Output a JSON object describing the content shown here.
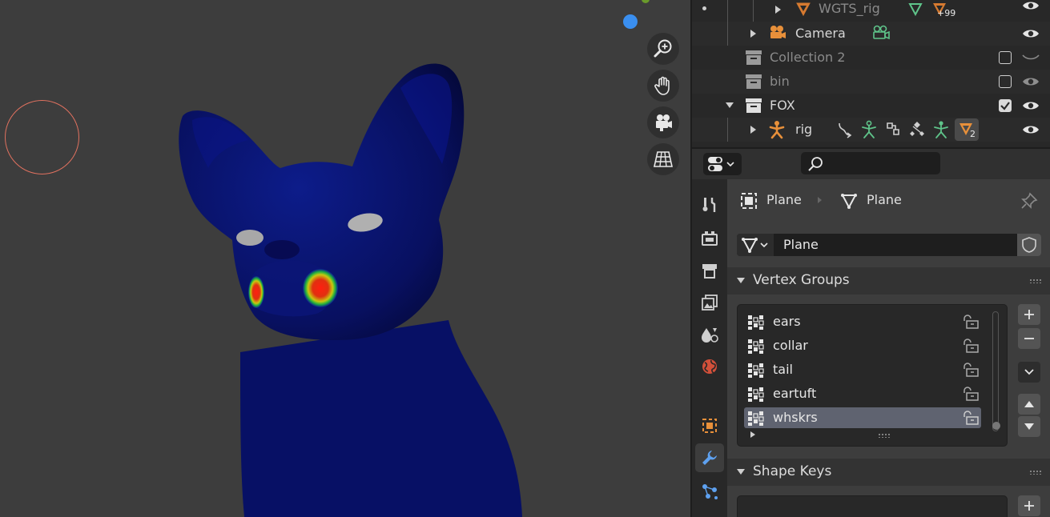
{
  "outliner": {
    "rows": [
      {
        "label": "WGTS_rig",
        "badge": "+99"
      },
      {
        "label": "Camera"
      },
      {
        "label": "Collection 2"
      },
      {
        "label": "bin"
      },
      {
        "label": "FOX"
      },
      {
        "label": "rig",
        "badge": "2"
      }
    ]
  },
  "properties": {
    "breadcrumb": {
      "object": "Plane",
      "data": "Plane"
    },
    "data_name": "Plane",
    "vertex_groups": {
      "title": "Vertex Groups",
      "items": [
        "ears",
        "collar",
        "tail",
        "eartuft",
        "whskrs"
      ],
      "selected": "whskrs"
    },
    "shape_keys": {
      "title": "Shape Keys"
    }
  },
  "colors": {
    "accent_blue": "#3a8ff0",
    "brush": "#e0715f",
    "object_orange": "#e8903a",
    "modifier_blue": "#5ea1f0",
    "armature_green": "#5fc48a"
  }
}
